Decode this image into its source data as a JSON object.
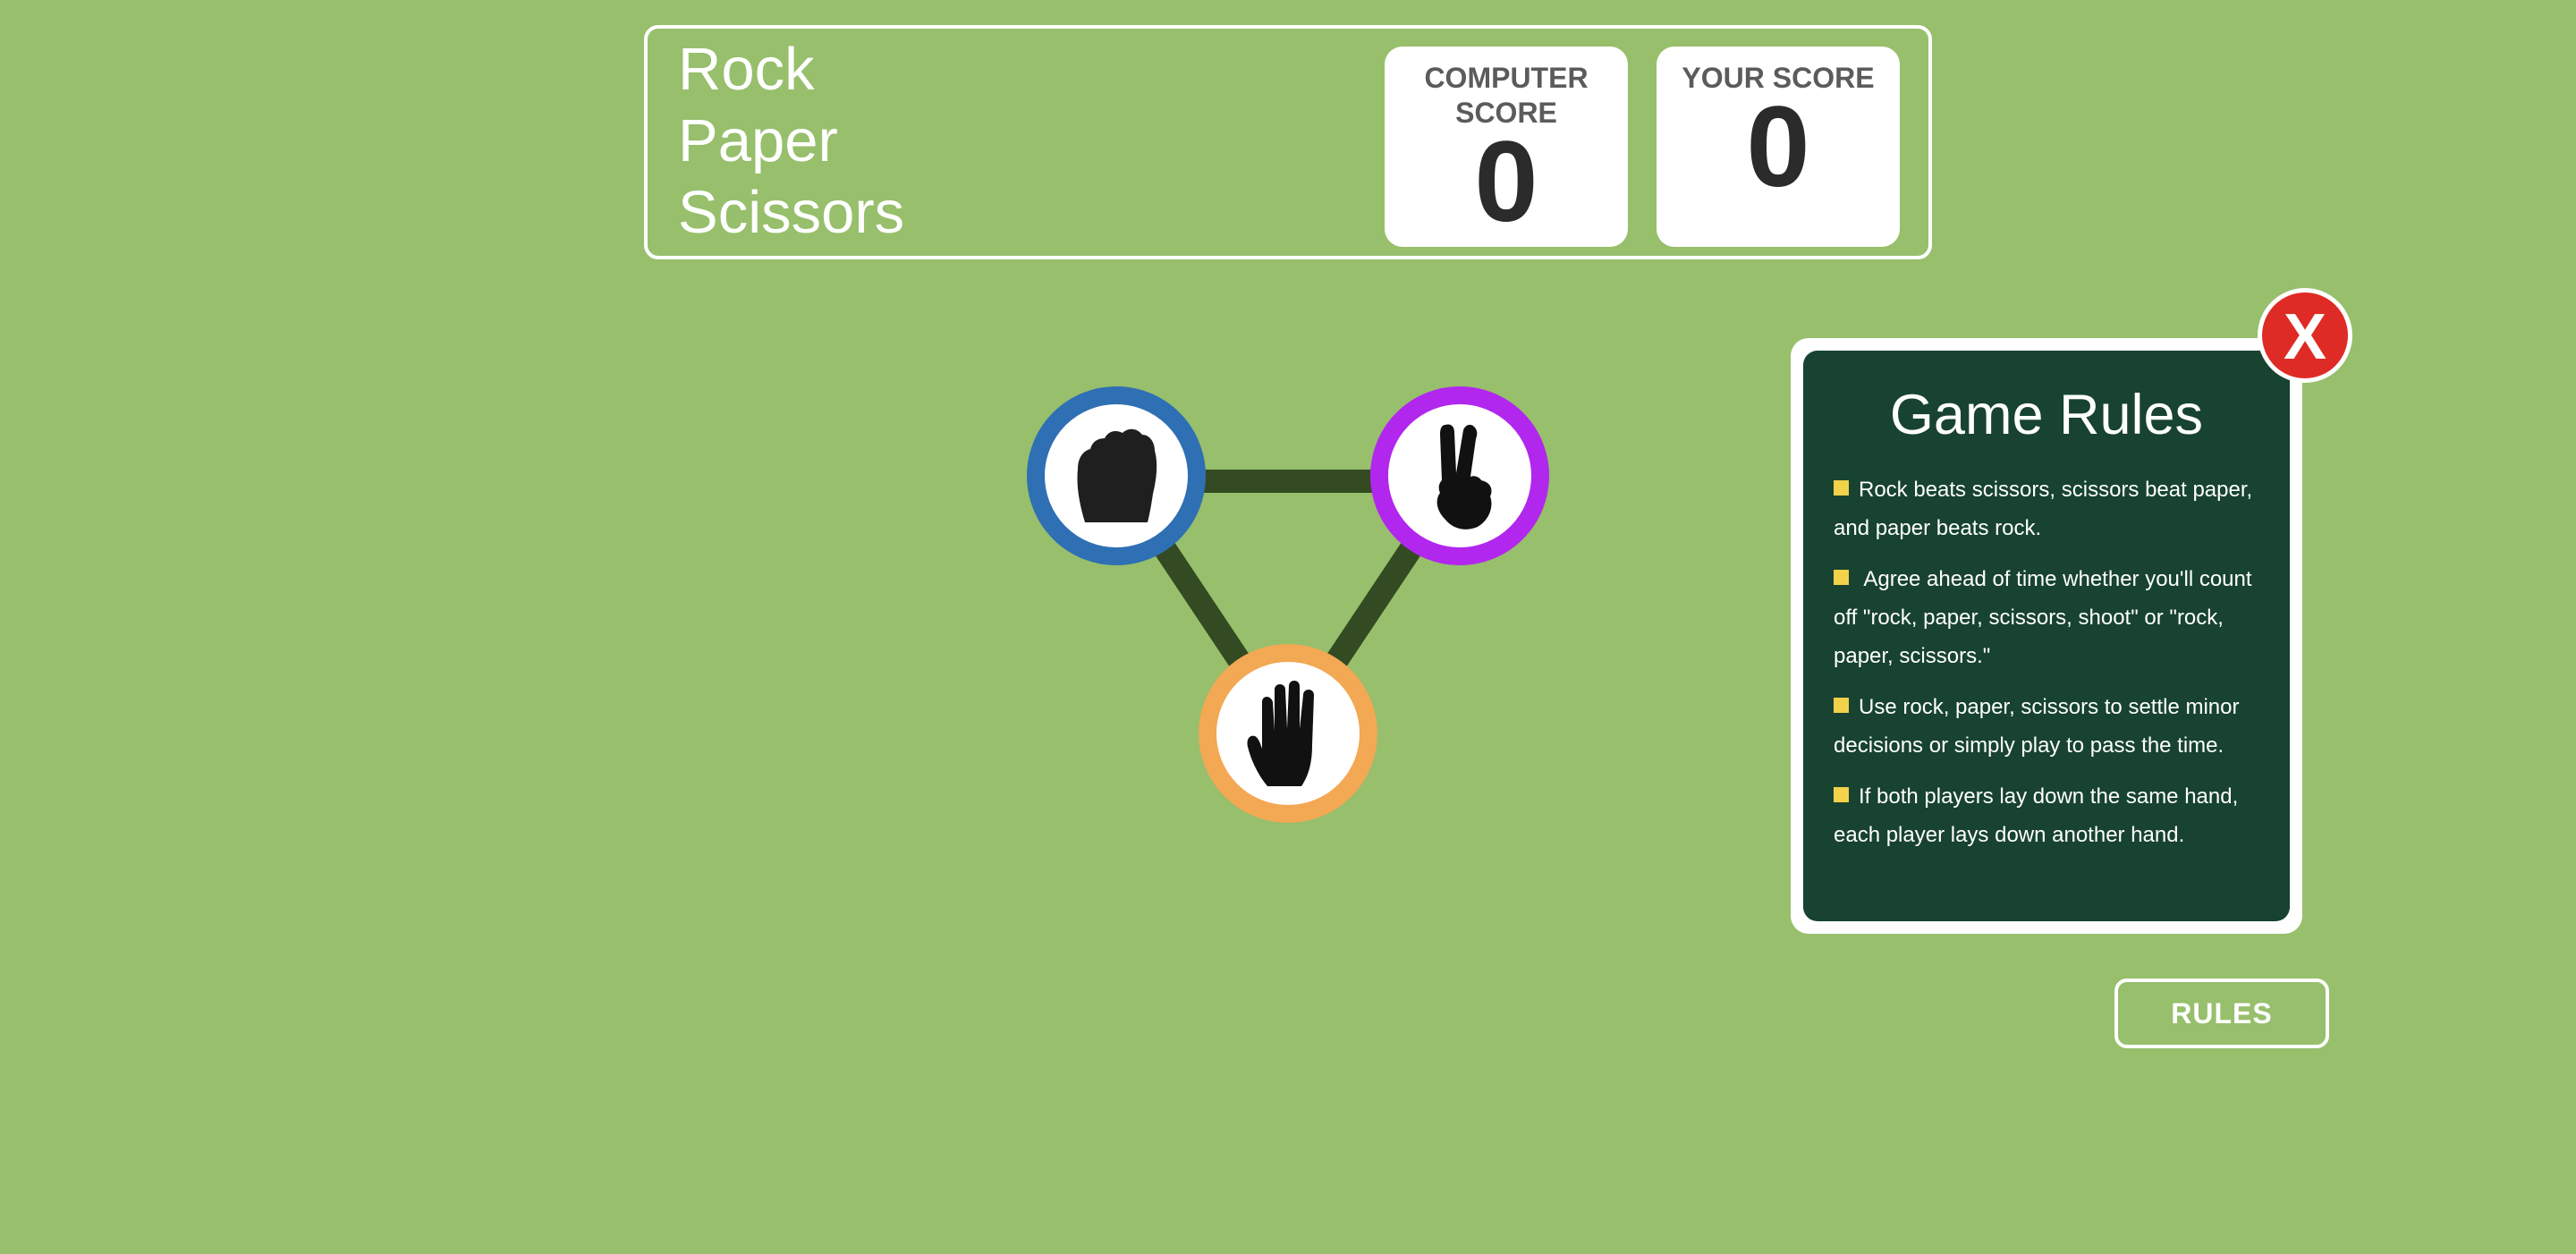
{
  "header": {
    "title_lines": [
      "Rock",
      "Paper",
      "Scissors"
    ],
    "computer_score_label": "COMPUTER SCORE",
    "computer_score": "0",
    "user_score_label": "YOUR SCORE",
    "user_score": "0"
  },
  "choices": [
    {
      "name": "rock",
      "icon": "fist-icon",
      "border_color": "#2f6fb4"
    },
    {
      "name": "scissors",
      "icon": "victory-hand-icon",
      "border_color": "#b127ee"
    },
    {
      "name": "paper",
      "icon": "open-hand-icon",
      "border_color": "#f3a854"
    }
  ],
  "rules_panel": {
    "title": "Game Rules",
    "rules": [
      "Rock beats scissors, scissors beat paper, and paper beats rock.",
      " Agree ahead of time whether you'll count off \"rock, paper, scissors, shoot\" or \"rock, paper, scissors.\"",
      "Use rock, paper, scissors to settle minor decisions or simply play to pass the time.",
      "If both players lay down the same hand, each player lays down another hand."
    ],
    "close_label": "X"
  },
  "rules_button_label": "RULES",
  "colors": {
    "background": "#97bf6c",
    "rules_panel_bg": "#174330",
    "bullet": "#f2d14b",
    "close_button": "#df2b25",
    "connector": "#344a22"
  }
}
